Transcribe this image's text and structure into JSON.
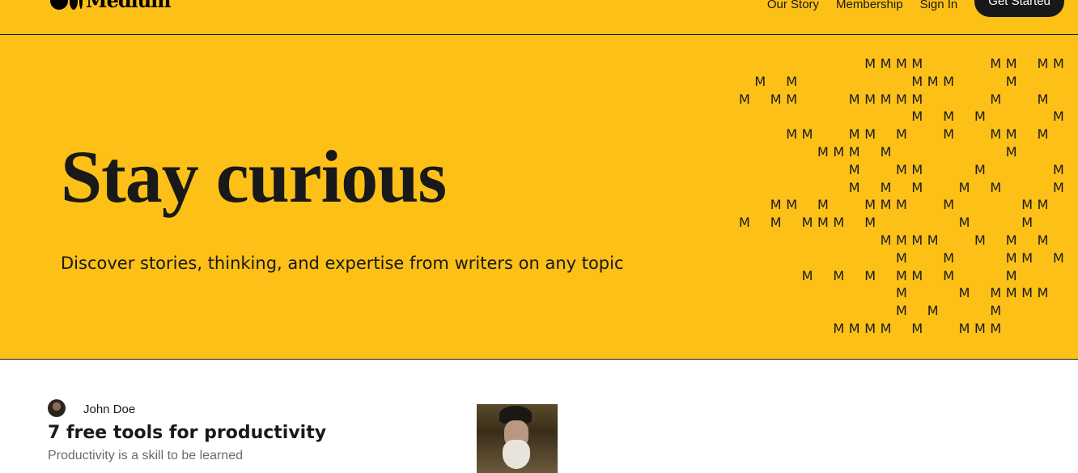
{
  "header": {
    "logo_text": "Medium",
    "nav": [
      "Our Story",
      "Membership",
      "Sign In"
    ],
    "cta": "Get Started"
  },
  "hero": {
    "title": "Stay curious",
    "subtitle": "Discover stories, thinking, and expertise from writers on any topic",
    "pattern_glyph": "M"
  },
  "post": {
    "author": "John Doe",
    "title": "7 free tools for productivity",
    "subtitle": "Productivity is a skill to be learned"
  },
  "colors": {
    "brand_yellow": "#fcc017",
    "text": "#191919",
    "muted": "#6b6b6b"
  }
}
